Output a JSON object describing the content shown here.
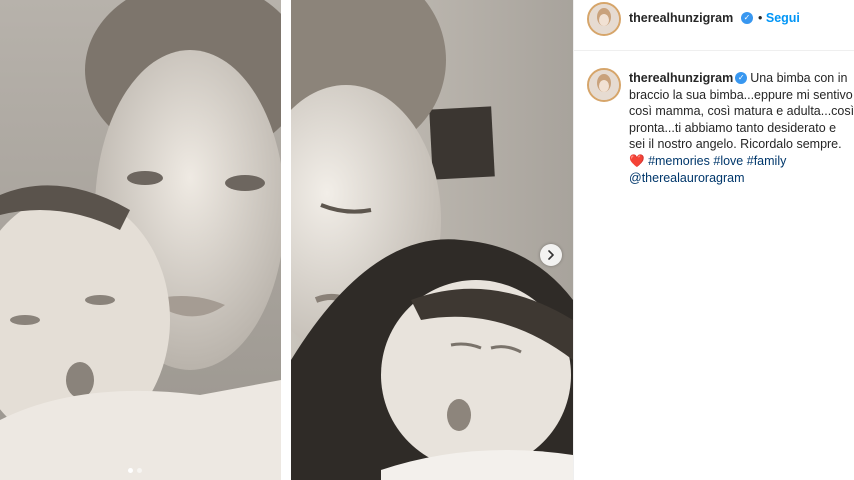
{
  "post": {
    "images": [
      {
        "alt": "Foto in bianco e nero di una donna con la sua neonata"
      },
      {
        "alt": "Foto in bianco e nero di una donna che tiene in braccio la neonata addormentata"
      }
    ],
    "carousel": {
      "next_icon": "chevron-right-icon",
      "count": 2,
      "active": 1
    }
  },
  "header": {
    "username": "therealhunzigram",
    "verified_icon": "verified-badge-icon",
    "separator": "•",
    "follow_label": "Segui"
  },
  "caption": {
    "username": "therealhunzigram",
    "text_1": "Una bimba con in braccio la sua bimba...eppure mi sentivo così mamma, così matura e adulta...così pronta...ti abbiamo tanto desiderato e sei il nostro angelo. Ricordalo sempre. ",
    "heart": "❤️",
    "tag_1": "#memories",
    "tag_2": "#love",
    "tag_3": "#family",
    "mention": "@therealauroragram"
  },
  "colors": {
    "accent": "#0095f6",
    "verified": "#3897f0",
    "text": "#262626",
    "link": "#00376b"
  }
}
